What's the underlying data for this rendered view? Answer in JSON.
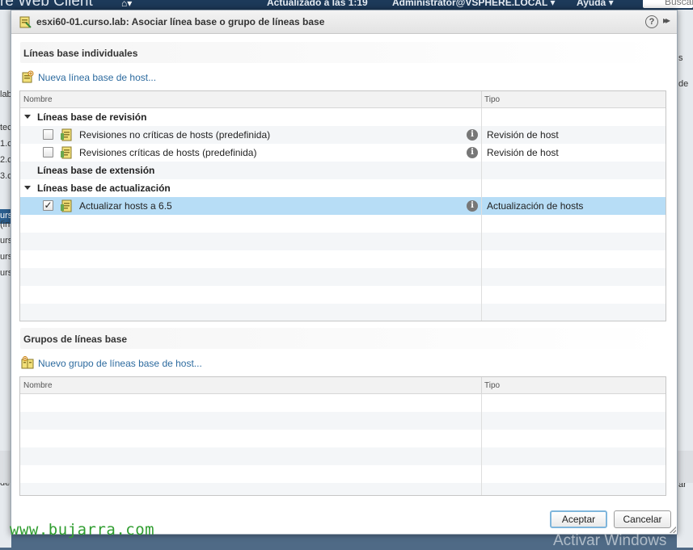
{
  "background_app": {
    "title": "re Web Client",
    "updated": "Actualizado a las 1:19",
    "user": "Administrator@VSPHERE.LOCAL ▾",
    "help": "Ayuda ▾",
    "search": "Buscar",
    "left_fragments": [
      "lab",
      "tec",
      "1.c",
      "2.c",
      "3.c",
      "urs",
      "(in",
      "urs",
      "urs",
      "urs",
      "de"
    ],
    "right_fragments": [
      "s",
      "de",
      "ar"
    ],
    "watermark_site": "www.bujarra.com",
    "watermark_os": "Activar Windows"
  },
  "dialog": {
    "title": "esxi60-01.curso.lab: Asociar línea base o grupo de líneas base",
    "help_icon": "?",
    "expand_icon": "▸▸",
    "individual": {
      "section_title": "Líneas base individuales",
      "new_link": "Nueva línea base de host...",
      "col_name": "Nombre",
      "col_type": "Tipo",
      "rows": [
        {
          "kind": "group",
          "label": "Líneas base de revisión",
          "expanded": true
        },
        {
          "kind": "item",
          "label": "Revisiones no críticas de hosts (predefinida)",
          "type": "Revisión de host",
          "checked": false
        },
        {
          "kind": "item",
          "label": "Revisiones críticas de hosts (predefinida)",
          "type": "Revisión de host",
          "checked": false
        },
        {
          "kind": "group",
          "label": "Líneas base de extensión",
          "expanded": false
        },
        {
          "kind": "group",
          "label": "Líneas base de actualización",
          "expanded": true
        },
        {
          "kind": "item",
          "label": "Actualizar hosts a 6.5",
          "type": "Actualización de hosts",
          "checked": true,
          "selected": true
        }
      ]
    },
    "groups": {
      "section_title": "Grupos de líneas base",
      "new_link": "Nuevo grupo de líneas base de host...",
      "col_name": "Nombre",
      "col_type": "Tipo"
    },
    "buttons": {
      "ok": "Aceptar",
      "cancel": "Cancelar"
    }
  },
  "colors": {
    "selection": "#b7ddf6",
    "link": "#2d6b9f",
    "header_bar": "#1d3a5a",
    "watermark": "#2f9d2f"
  }
}
